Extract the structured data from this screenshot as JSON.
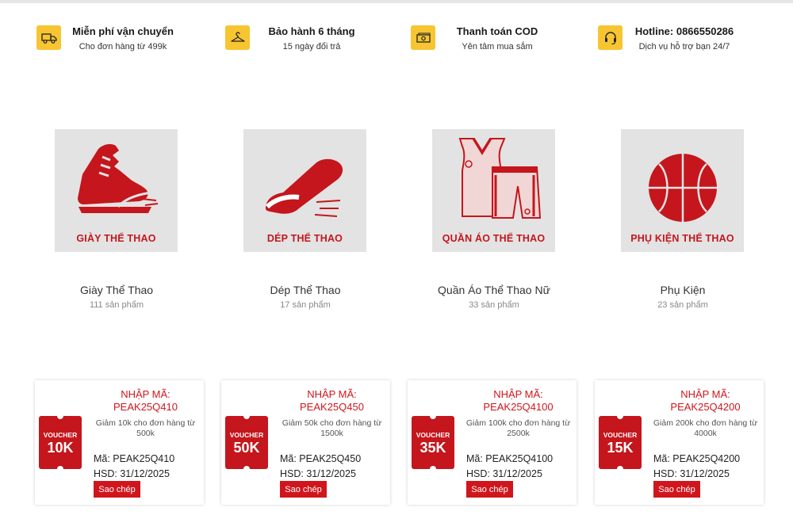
{
  "features": [
    {
      "icon": "truck-icon",
      "title": "Miễn phí vận chuyển",
      "subtitle": "Cho đơn hàng từ 499k"
    },
    {
      "icon": "hanger-icon",
      "title": "Bảo hành 6 tháng",
      "subtitle": "15 ngày đổi trả"
    },
    {
      "icon": "cash-icon",
      "title": "Thanh toán COD",
      "subtitle": "Yên tâm mua sắm"
    },
    {
      "icon": "headset-icon",
      "title": "Hotline: 0866550286",
      "subtitle": "Dịch vụ hỗ trợ bạn 24/7"
    }
  ],
  "categories": [
    {
      "icon": "sneaker-icon",
      "image_label": "GIÀY THỂ THAO",
      "name": "Giày Thể Thao",
      "count": "111 sản phẩm"
    },
    {
      "icon": "slide-sandal-icon",
      "image_label": "DÉP THỂ THAO",
      "name": "Dép Thể Thao",
      "count": "17 sản phẩm"
    },
    {
      "icon": "jersey-shorts-icon",
      "image_label": "QUẦN ÁO THỂ THAO",
      "name": "Quần Áo Thể Thao Nữ",
      "count": "33 sản phẩm"
    },
    {
      "icon": "basketball-icon",
      "image_label": "PHỤ KIỆN THỂ THAO",
      "name": "Phụ Kiện",
      "count": "23 sản phẩm"
    }
  ],
  "vouchers": [
    {
      "ticket_label": "VOUCHER",
      "ticket_value": "10K",
      "title_line1": "NHẬP MÃ:",
      "title_line2": "PEAK25Q410",
      "description": "Giảm 10k cho đơn hàng từ 500k",
      "code": "Mã: PEAK25Q410",
      "expiry": "HSD: 31/12/2025",
      "button": "Sao chép"
    },
    {
      "ticket_label": "VOUCHER",
      "ticket_value": "50K",
      "title_line1": "NHẬP MÃ:",
      "title_line2": "PEAK25Q450",
      "description": "Giảm 50k cho đơn hàng từ 1500k",
      "code": "Mã: PEAK25Q450",
      "expiry": "HSD: 31/12/2025",
      "button": "Sao chép"
    },
    {
      "ticket_label": "VOUCHER",
      "ticket_value": "35K",
      "title_line1": "NHẬP MÃ:",
      "title_line2": "PEAK25Q4100",
      "description": "Giảm 100k cho đơn hàng từ 2500k",
      "code": "Mã: PEAK25Q4100",
      "expiry": "HSD: 31/12/2025",
      "button": "Sao chép"
    },
    {
      "ticket_label": "VOUCHER",
      "ticket_value": "15K",
      "title_line1": "NHẬP MÃ:",
      "title_line2": "PEAK25Q4200",
      "description": "Giảm 200k cho đơn hàng từ 4000k",
      "code": "Mã: PEAK25Q4200",
      "expiry": "HSD: 31/12/2025",
      "button": "Sao chép"
    }
  ],
  "colors": {
    "accent": "#d0161c",
    "icon_badge": "#f7c531",
    "thumb_bg": "#e3e3e3"
  }
}
